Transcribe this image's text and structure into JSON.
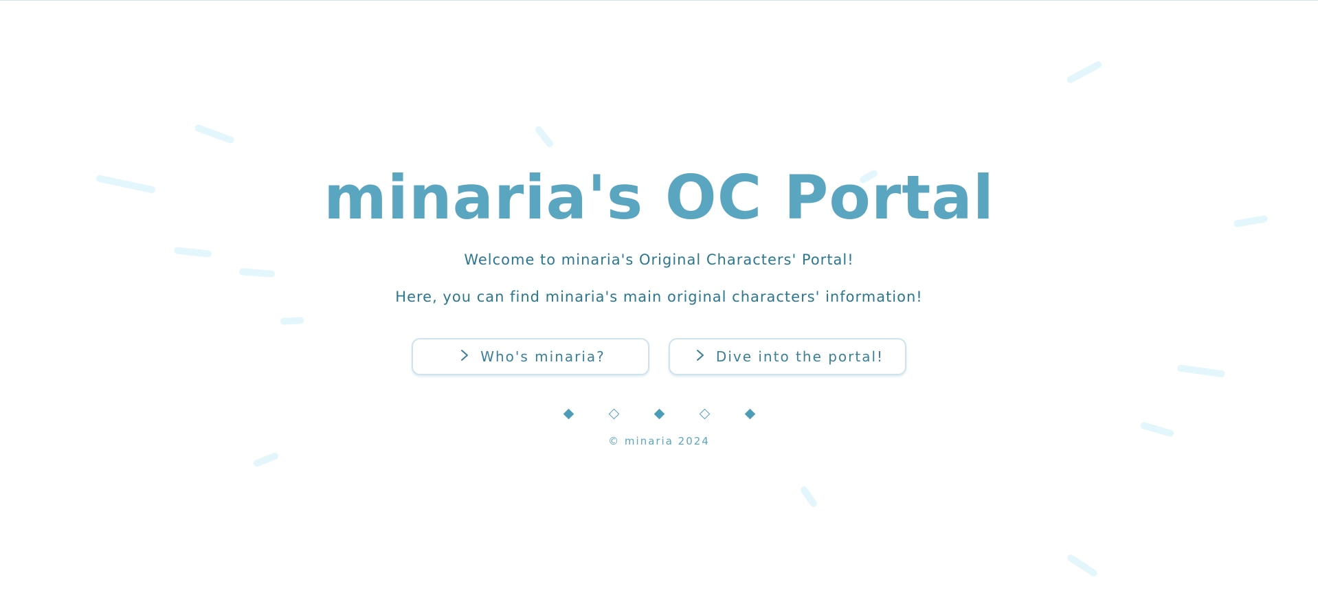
{
  "page": {
    "title": "minaria's OC Portal",
    "welcome_line": "Welcome to minaria's Original Characters' Portal!",
    "info_line": "Here, you can find minaria's main original characters' information!"
  },
  "buttons": {
    "who": {
      "label": "Who's minaria?",
      "icon": "chevron-right-icon"
    },
    "dive": {
      "label": "Dive into the portal!",
      "icon": "chevron-right-icon"
    }
  },
  "decor": {
    "diamonds": [
      "filled",
      "hollow",
      "filled",
      "hollow",
      "filled"
    ]
  },
  "footer": {
    "copyright": "© minaria 2024"
  },
  "colors": {
    "title": "#5aa5bf",
    "text": "#2b7690",
    "accent": "#4c9db8",
    "streak": "#e3f6fb",
    "button_border": "#cfe3ec"
  }
}
